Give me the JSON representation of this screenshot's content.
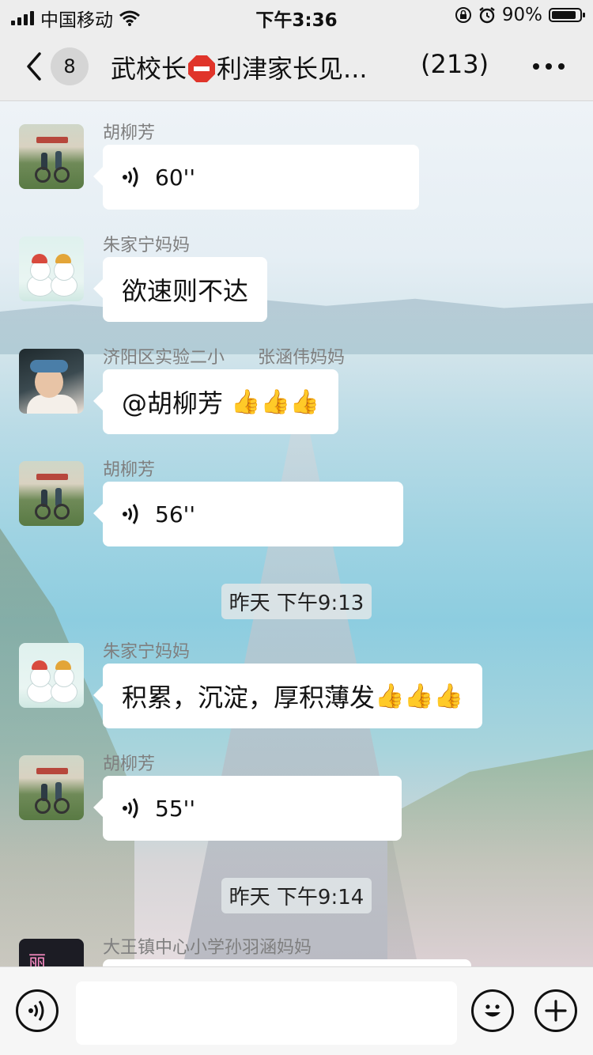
{
  "status_bar": {
    "carrier": "中国移动",
    "time": "下午3:36",
    "battery": "90%",
    "battery_level": 0.9
  },
  "nav": {
    "back_badge": "8",
    "title_part1": "武校长",
    "title_icon": "stop-sign-icon",
    "title_part2": "利津家长见...",
    "member_count": "(213)"
  },
  "messages": [
    {
      "sender": "胡柳芳",
      "type": "voice",
      "duration": "60''",
      "avatar": "bike-photo"
    },
    {
      "sender": "朱家宁妈妈",
      "type": "text",
      "text": "欲速则不达",
      "avatar": "snowman"
    },
    {
      "sender": "济阳区实验二小      张涵伟妈妈",
      "type": "text",
      "text": "@胡柳芳 ",
      "emoji": "👍👍👍",
      "avatar": "kid-photo"
    },
    {
      "sender": "胡柳芳",
      "type": "voice",
      "duration": "56''",
      "avatar": "bike-photo"
    },
    {
      "sender": "朱家宁妈妈",
      "type": "text",
      "text": "积累，沉淀，厚积薄发",
      "emoji": "👍👍👍",
      "avatar": "snowman"
    },
    {
      "sender": "胡柳芳",
      "type": "voice",
      "duration": "55''",
      "avatar": "bike-photo"
    },
    {
      "sender": "大王镇中心小学孙羽涵妈妈",
      "type": "text",
      "text": "",
      "avatar": "pink-text",
      "avatar_text": "丽"
    }
  ],
  "timestamps": [
    "昨天 下午9:13",
    "昨天 下午9:14"
  ],
  "input_bar": {
    "voice_icon": "voice-icon",
    "emoji_icon": "emoji-icon",
    "plus_icon": "plus-icon",
    "placeholder": ""
  }
}
